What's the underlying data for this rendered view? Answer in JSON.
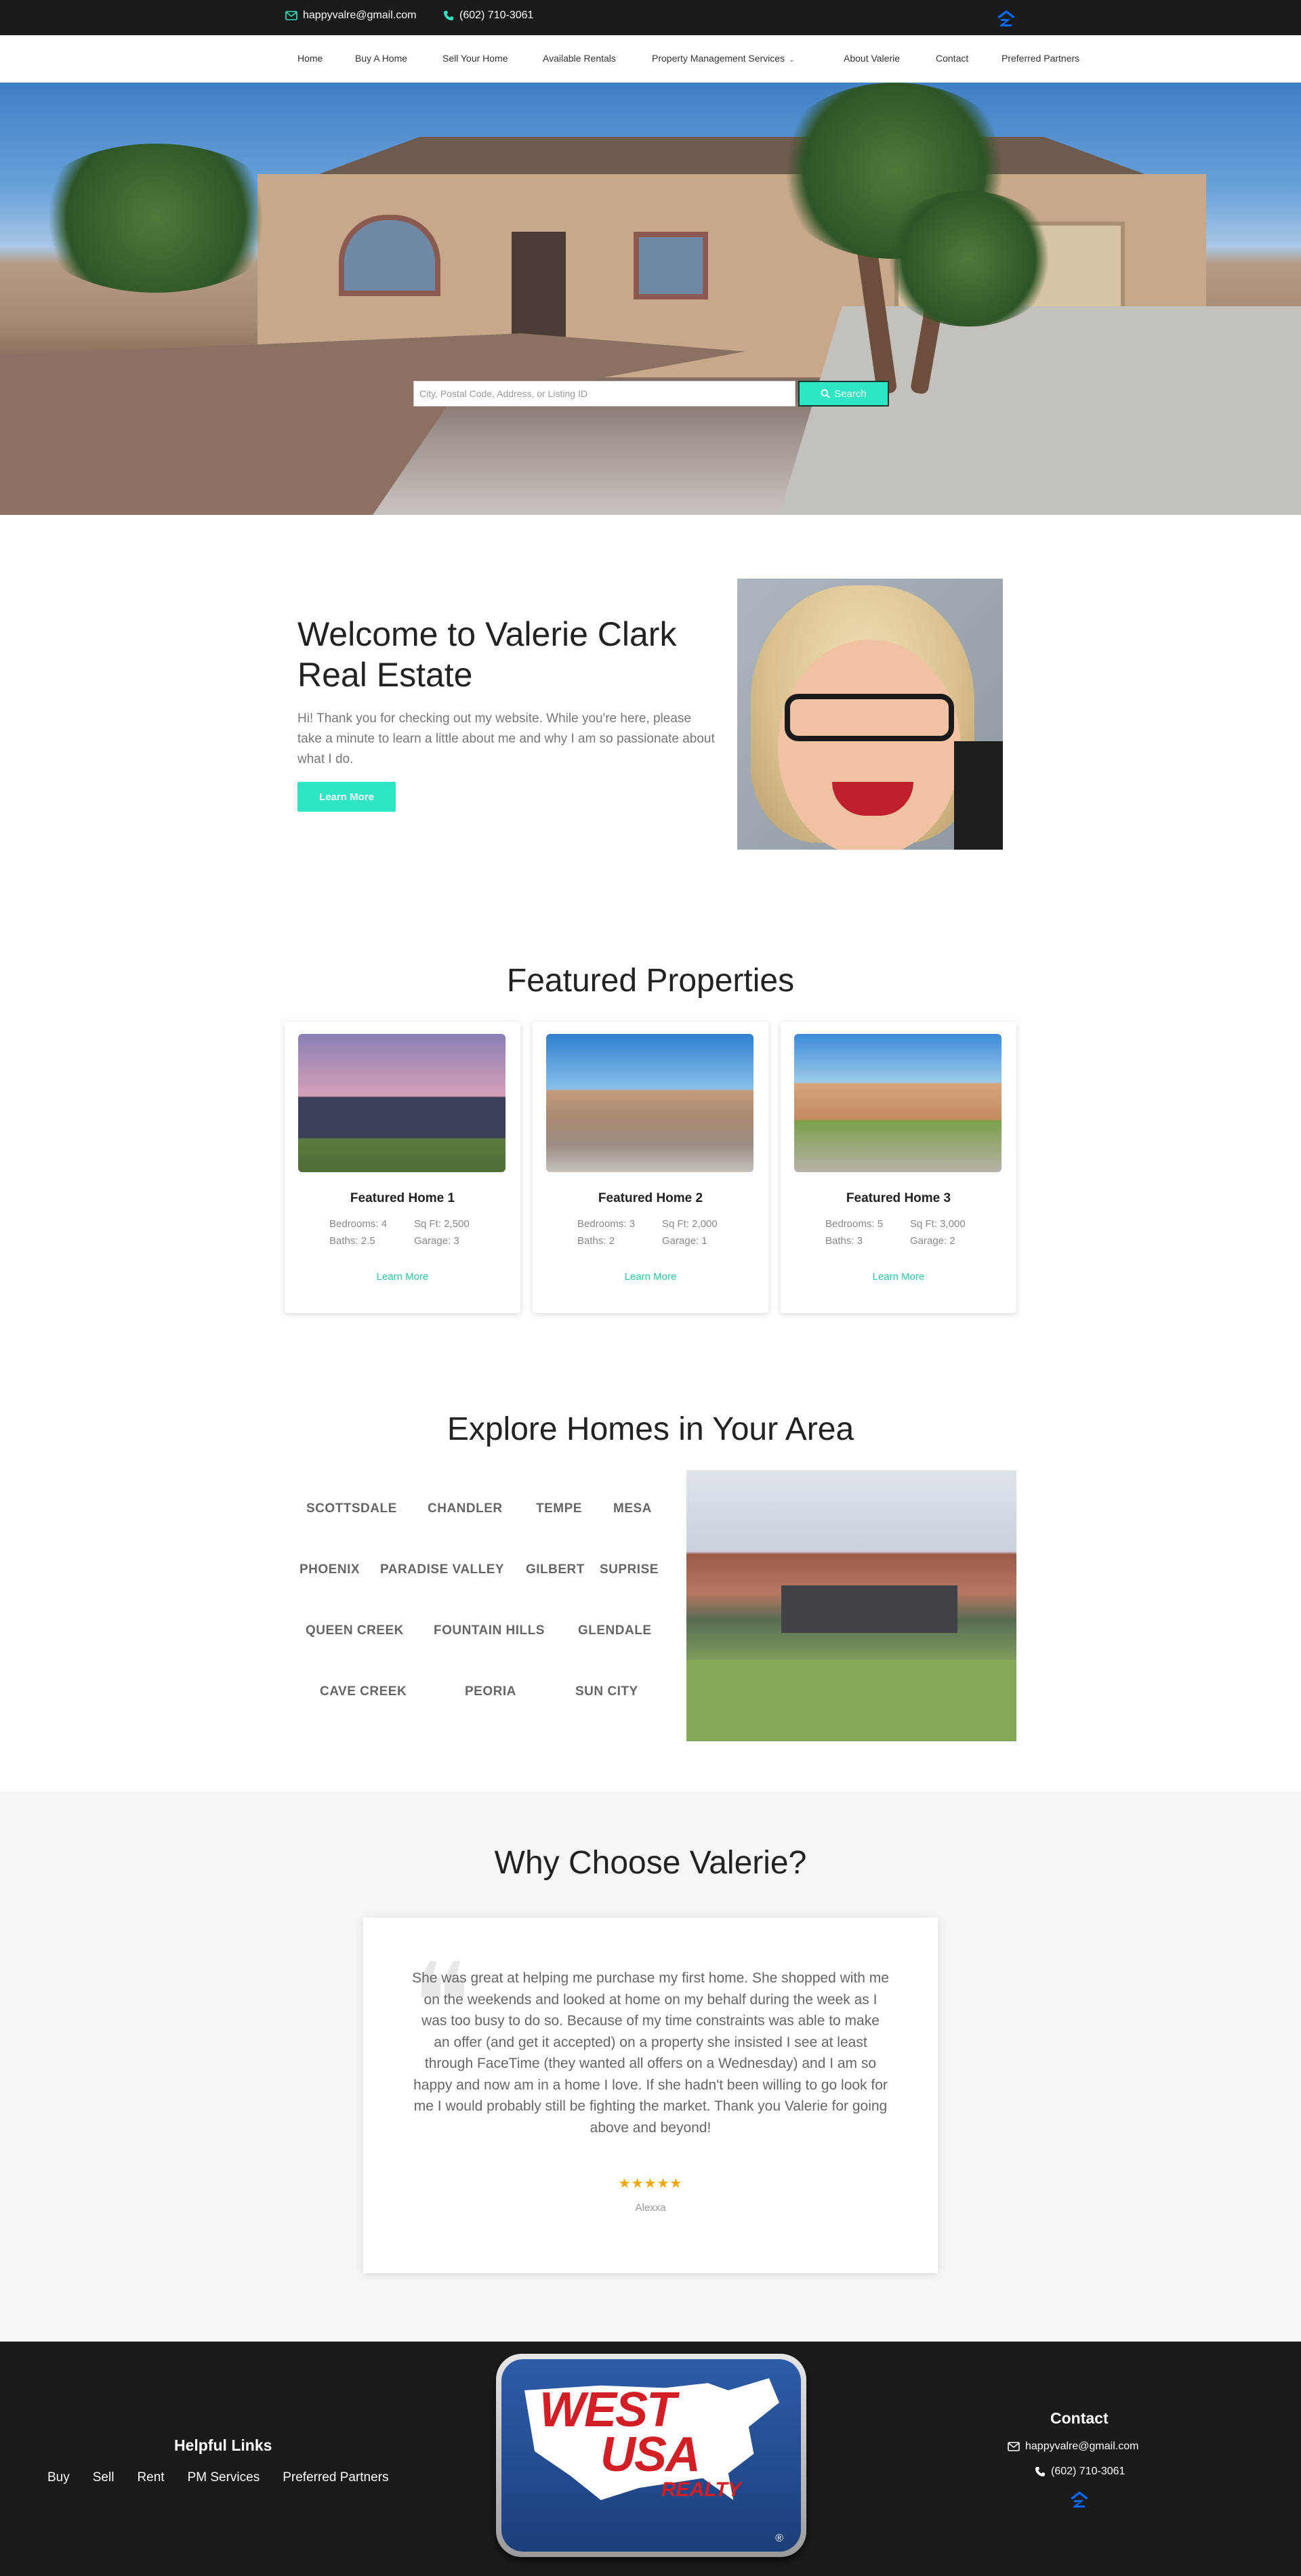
{
  "topbar": {
    "email": "happyvalre@gmail.com",
    "phone": "(602) 710-3061",
    "email_icon": "envelope-icon",
    "phone_icon": "phone-icon",
    "zillow_icon": "zillow-icon"
  },
  "nav": {
    "items": [
      {
        "label": "Home"
      },
      {
        "label": "Buy A Home"
      },
      {
        "label": "Sell Your Home"
      },
      {
        "label": "Available Rentals"
      },
      {
        "label": "Property Management Services",
        "has_dropdown": true
      },
      {
        "label": "About Valerie"
      },
      {
        "label": "Contact"
      },
      {
        "label": "Preferred Partners"
      }
    ]
  },
  "hero": {
    "search_placeholder": "City, Postal Code, Address, or Listing ID",
    "search_value": "",
    "search_button": "Search",
    "search_icon": "search-icon"
  },
  "welcome": {
    "title": "Welcome to Valerie Clark Real Estate",
    "text": "Hi! Thank you for checking out my website. While you're here, please take a minute to learn a little about me and why I am so passionate about what I do.",
    "button": "Learn More"
  },
  "featured": {
    "title": "Featured Properties",
    "cards": [
      {
        "name": "Featured Home 1",
        "bedrooms": "Bedrooms: 4",
        "sqft": "Sq Ft: 2,500",
        "baths": "Baths: 2.5",
        "garage": "Garage: 3",
        "link": "Learn More"
      },
      {
        "name": "Featured Home 2",
        "bedrooms": "Bedrooms: 3",
        "sqft": "Sq Ft: 2,000",
        "baths": "Baths: 2",
        "garage": "Garage: 1",
        "link": "Learn More"
      },
      {
        "name": "Featured Home 3",
        "bedrooms": "Bedrooms: 5",
        "sqft": "Sq Ft: 3,000",
        "baths": "Baths: 3",
        "garage": "Garage: 2",
        "link": "Learn More"
      }
    ]
  },
  "explore": {
    "title": "Explore Homes in Your Area",
    "areas": [
      "SCOTTSDALE",
      "CHANDLER",
      "TEMPE",
      "MESA",
      "PHOENIX",
      "PARADISE VALLEY",
      "GILBERT",
      "SUPRISE",
      "QUEEN CREEK",
      "FOUNTAIN HILLS",
      "GLENDALE",
      "CAVE CREEK",
      "PEORIA",
      "SUN CITY"
    ]
  },
  "testimonials": {
    "title": "Why Choose Valerie?",
    "quote": "She was great at helping me purchase my first home. She shopped with me on the weekends and looked at home on my behalf during the week as I was too busy to do so. Because of my time constraints was able to make an offer (and get it accepted) on a property she insisted I see at least through FaceTime (they wanted all offers on a Wednesday) and I am so happy and now am in a home I love. If she hadn't been willing to go look for me I would probably still be fighting the market. Thank you Valerie for going above and beyond!",
    "stars": "★★★★★",
    "rating": 5,
    "author": "Alexxa"
  },
  "footer": {
    "helpful_title": "Helpful Links",
    "links": [
      "Buy",
      "Sell",
      "Rent",
      "PM Services",
      "Preferred Partners"
    ],
    "logo": {
      "line1": "WEST",
      "line2": "USA",
      "line3": "REALTY",
      "reg": "®"
    },
    "contact_title": "Contact",
    "email": "happyvalre@gmail.com",
    "phone": "(602) 710-3061"
  },
  "colors": {
    "accent": "#2ee6c3",
    "dark": "#1b1b1b",
    "zillow_blue": "#006aff",
    "logo_red": "#d21f26",
    "logo_blue": "#1b3f7c"
  }
}
